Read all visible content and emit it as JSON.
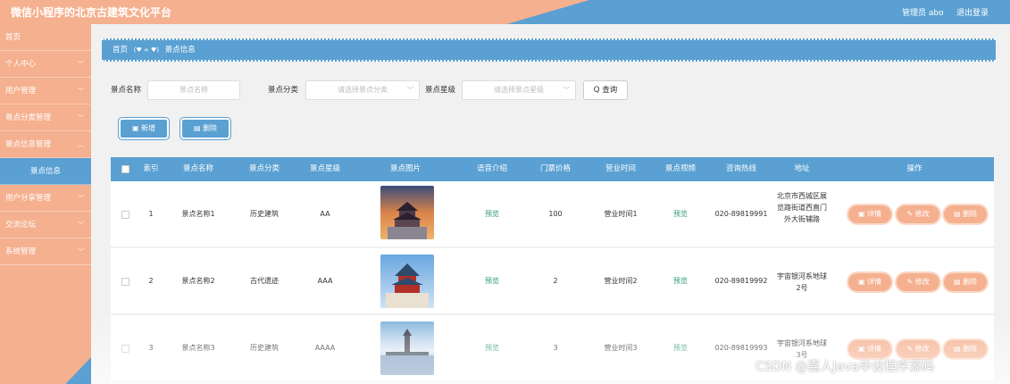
{
  "header": {
    "title": "微信小程序的北京古建筑文化平台",
    "admin": "管理员 abo",
    "logout": "退出登录"
  },
  "sidebar": {
    "items": [
      {
        "label": "首页",
        "chevron": false
      },
      {
        "label": "个人中心",
        "chevron": true
      },
      {
        "label": "用户管理",
        "chevron": true
      },
      {
        "label": "景点分类管理",
        "chevron": true
      },
      {
        "label": "景点信息管理",
        "chevron": true
      },
      {
        "label": "景点信息",
        "chevron": false,
        "active": true
      },
      {
        "label": "用户分享管理",
        "chevron": true
      },
      {
        "label": "交流论坛",
        "chevron": true
      },
      {
        "label": "系统管理",
        "chevron": true
      }
    ]
  },
  "breadcrumb": {
    "home": "首页",
    "hearts": "(♥ ∞ ♥)",
    "current": "景点信息"
  },
  "search": {
    "name_label": "景点名称",
    "name_placeholder": "景点名称",
    "category_label": "景点分类",
    "category_placeholder": "请选择景点分类",
    "rating_label": "景点星级",
    "rating_placeholder": "请选择景点星级",
    "query_button": "Q 查询"
  },
  "actions": {
    "add": "新增",
    "delete": "删除"
  },
  "table": {
    "headers": [
      "索引",
      "景点名称",
      "景点分类",
      "景点星级",
      "景点图片",
      "语音介绍",
      "门票价格",
      "营业时间",
      "景点视频",
      "咨询热线",
      "地址",
      "操作"
    ],
    "rows": [
      {
        "index": "1",
        "name": "景点名称1",
        "category": "历史建筑",
        "rating": "AA",
        "audio": "预览",
        "price": "100",
        "hours": "营业时间1",
        "video": "预览",
        "phone": "020-89819991",
        "address": "北京市西城区展览路街道西直门外大街辅路"
      },
      {
        "index": "2",
        "name": "景点名称2",
        "category": "古代遗迹",
        "rating": "AAA",
        "audio": "预览",
        "price": "2",
        "hours": "营业时间2",
        "video": "预览",
        "phone": "020-89819992",
        "address": "宇宙银河系地球2号"
      },
      {
        "index": "3",
        "name": "景点名称3",
        "category": "历史建筑",
        "rating": "AAAA",
        "audio": "预览",
        "price": "3",
        "hours": "营业时间3",
        "video": "预览",
        "phone": "020-89819993",
        "address": "宇宙银河系地球3号"
      }
    ],
    "ops": {
      "detail": "详情",
      "edit": "修改",
      "delete": "删除"
    }
  },
  "watermark": "CSDN @嘉人Java毕设程序源码",
  "colors": {
    "salmon": "#f5b08f",
    "blue": "#5aa0d2",
    "link": "#2a9a6f"
  }
}
